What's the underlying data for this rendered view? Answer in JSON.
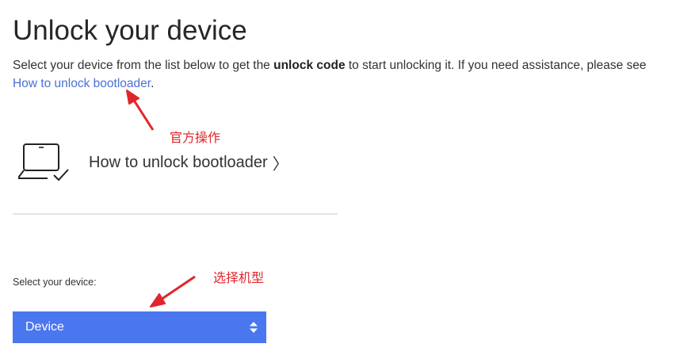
{
  "page": {
    "title": "Unlock your device",
    "intro_before": "Select your device from the list below to get the ",
    "intro_bold": "unlock code",
    "intro_after": " to start unlocking it. If you need assistance, please see",
    "intro_link": "How to unlock bootloader",
    "intro_period": "."
  },
  "card": {
    "label": "How to unlock bootloader",
    "chevron": "〉",
    "icon": "laptop-check-icon"
  },
  "device": {
    "label": "Select your device:",
    "selected": "Device",
    "icon": "up-down-arrows-icon",
    "color": "#4a76ef"
  },
  "annotations": {
    "official": "官方操作",
    "select_model": "选择机型",
    "color": "#e0262b"
  }
}
